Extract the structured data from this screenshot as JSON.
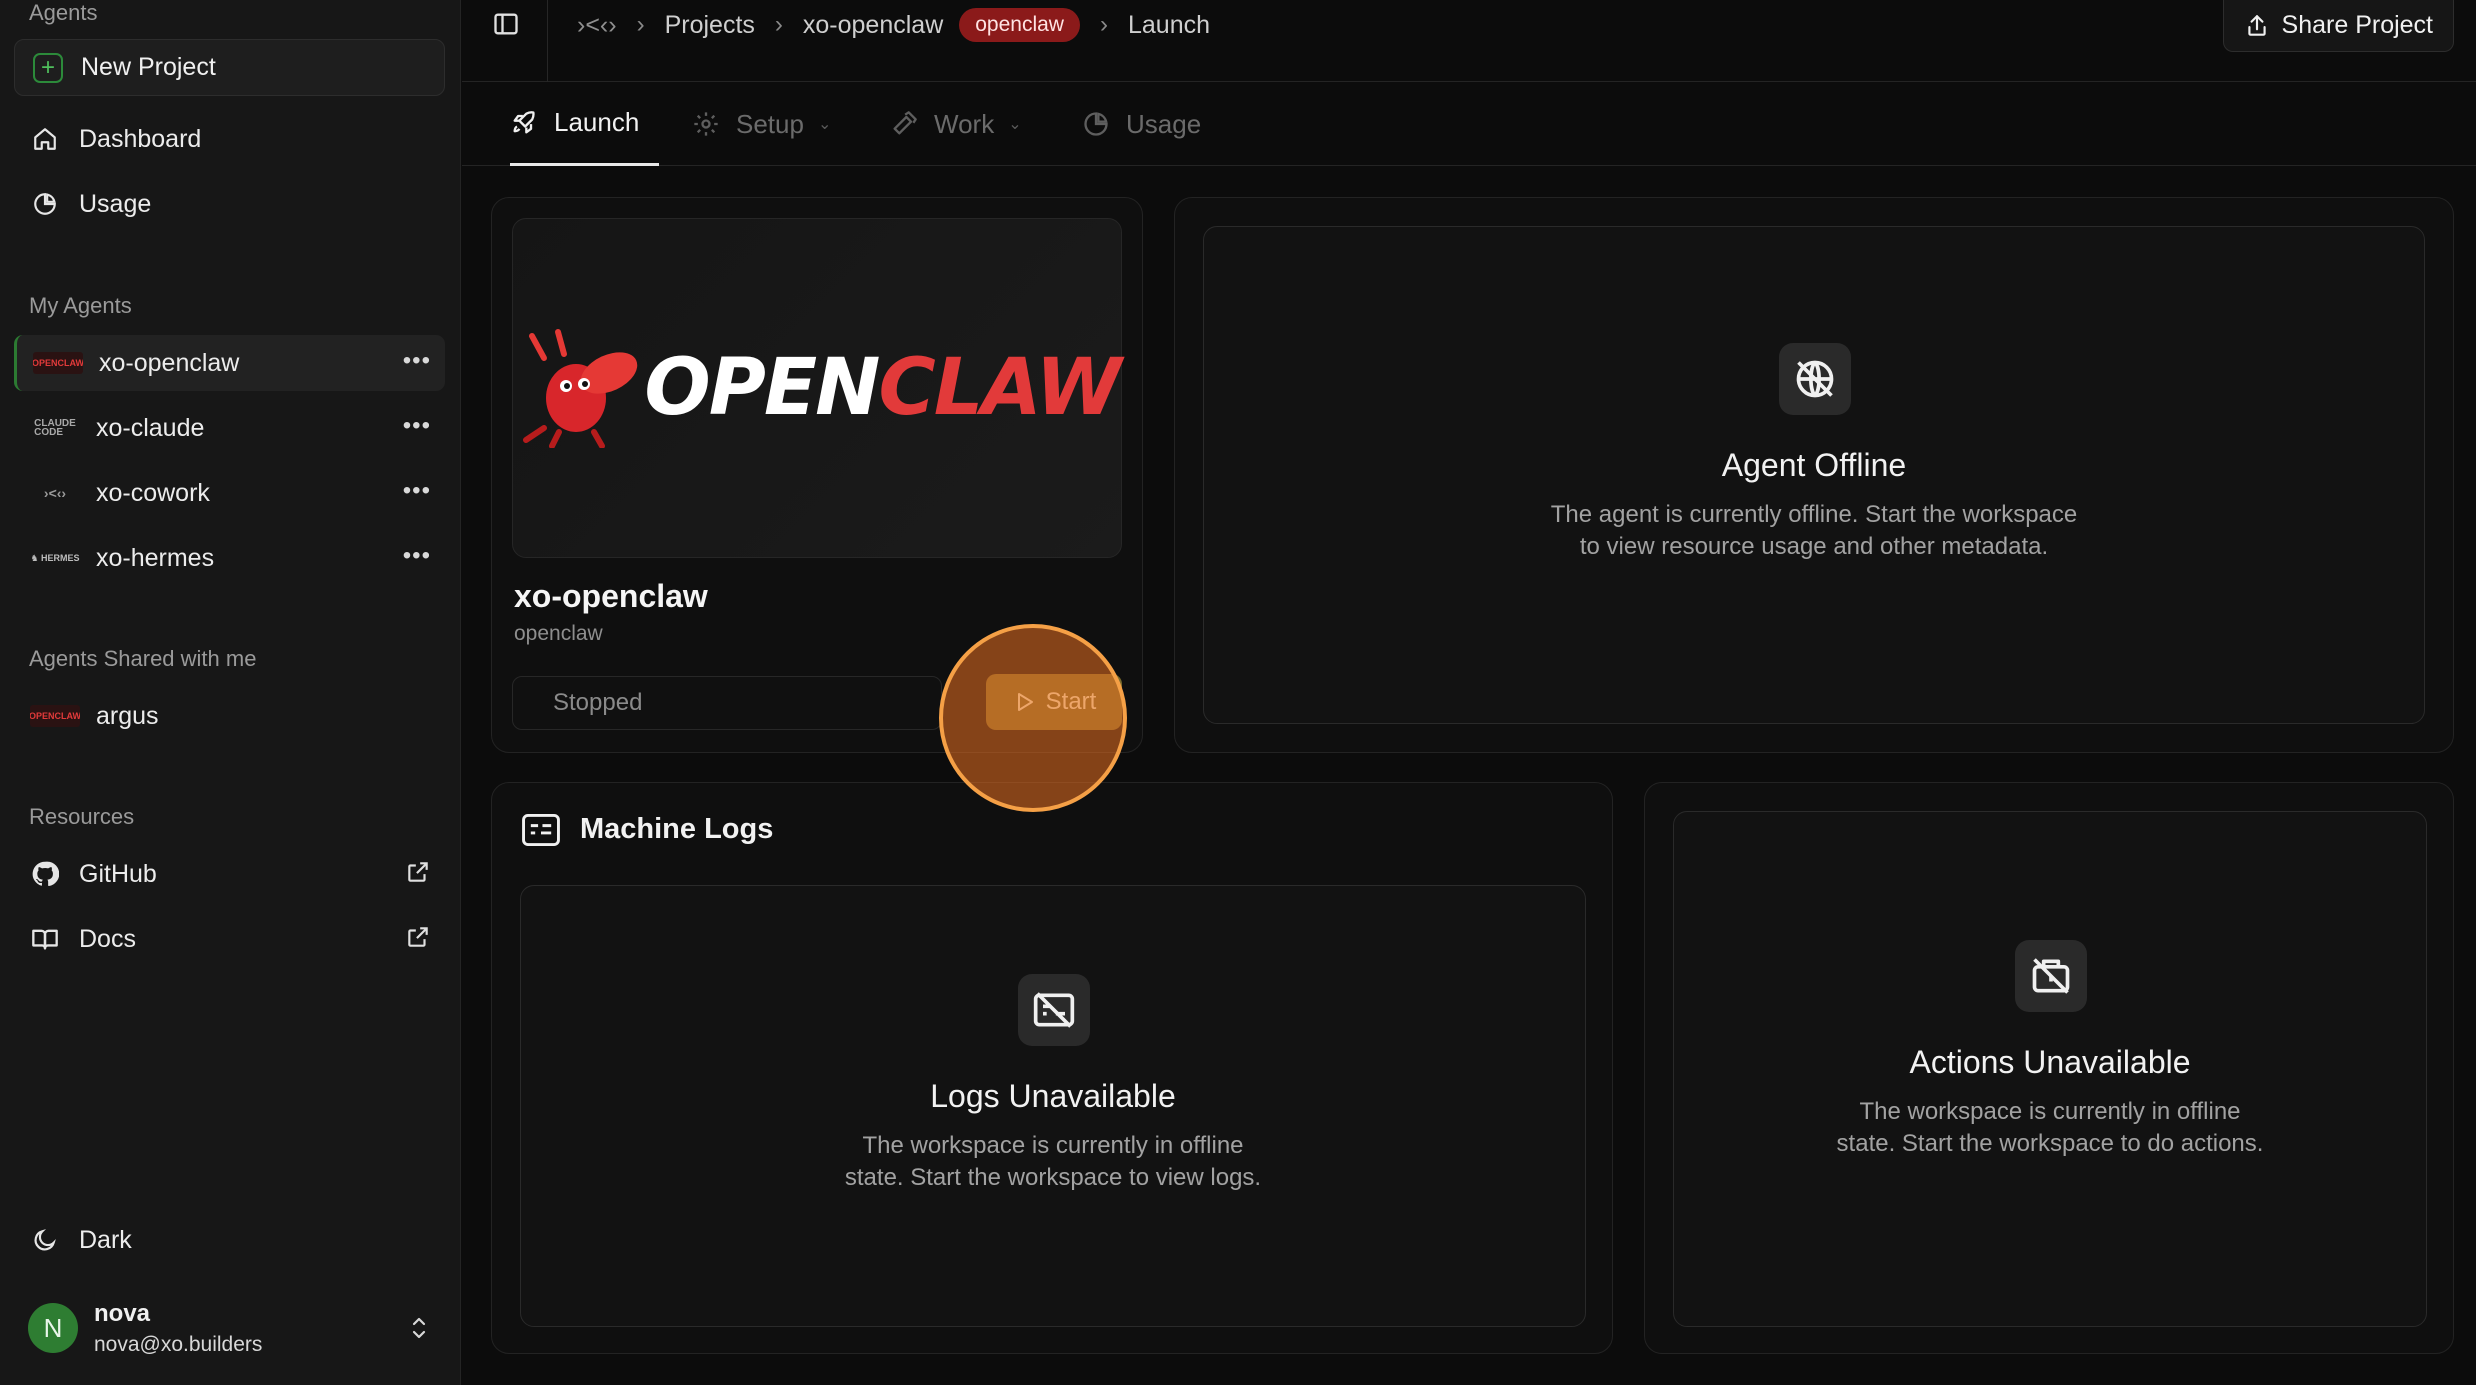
{
  "sidebar": {
    "agents_heading": "Agents",
    "new_project_label": "New Project",
    "nav": [
      {
        "label": "Dashboard",
        "icon": "home-icon"
      },
      {
        "label": "Usage",
        "icon": "pie-chart-icon"
      }
    ],
    "my_agents_heading": "My Agents",
    "my_agents": [
      {
        "name": "xo-openclaw",
        "logo": "openclaw-logo",
        "active": true
      },
      {
        "name": "xo-claude",
        "logo": "claude-code-logo",
        "active": false
      },
      {
        "name": "xo-cowork",
        "logo": "xo-logo",
        "active": false
      },
      {
        "name": "xo-hermes",
        "logo": "hermes-logo",
        "active": false
      }
    ],
    "shared_heading": "Agents Shared with me",
    "shared_agents": [
      {
        "name": "argus",
        "logo": "openclaw-logo"
      }
    ],
    "resources_heading": "Resources",
    "resources": [
      {
        "label": "GitHub",
        "icon": "github-icon"
      },
      {
        "label": "Docs",
        "icon": "book-icon"
      }
    ],
    "theme_label": "Dark",
    "user": {
      "initial": "N",
      "name": "nova",
      "email": "nova@xo.builders"
    }
  },
  "topbar": {
    "breadcrumb": {
      "logo_text": "›<‹›",
      "projects": "Projects",
      "project": "xo-openclaw",
      "badge": "openclaw",
      "page": "Launch"
    },
    "share_label": "Share Project"
  },
  "tabs": [
    {
      "label": "Launch",
      "icon": "rocket-icon",
      "active": true
    },
    {
      "label": "Setup",
      "icon": "gear-icon",
      "active": false
    },
    {
      "label": "Work",
      "icon": "hammer-icon",
      "active": false
    },
    {
      "label": "Usage",
      "icon": "pie-chart-icon",
      "active": false
    }
  ],
  "agent_card": {
    "logo_text_white": "OPEN",
    "logo_text_red": "CLAW",
    "title": "xo-openclaw",
    "subtitle": "openclaw",
    "status": "Stopped",
    "start_label": "Start"
  },
  "agent_offline": {
    "title": "Agent Offline",
    "desc_line1": "The agent is currently offline. Start the workspace",
    "desc_line2": "to view resource usage and other metadata."
  },
  "machine_logs": {
    "heading": "Machine Logs",
    "title": "Logs Unavailable",
    "desc_line1": "The workspace is currently in offline",
    "desc_line2": "state. Start the workspace to view logs."
  },
  "actions": {
    "title": "Actions Unavailable",
    "desc_line1": "The workspace is currently in offline",
    "desc_line2": "state. Start the workspace to do actions."
  },
  "colors": {
    "accent_green": "#2e7d32",
    "badge_red": "#8b1a1a",
    "start_button": "#7a6a2c",
    "highlight_orange": "#f5a046",
    "logo_red": "#e23a3a"
  }
}
